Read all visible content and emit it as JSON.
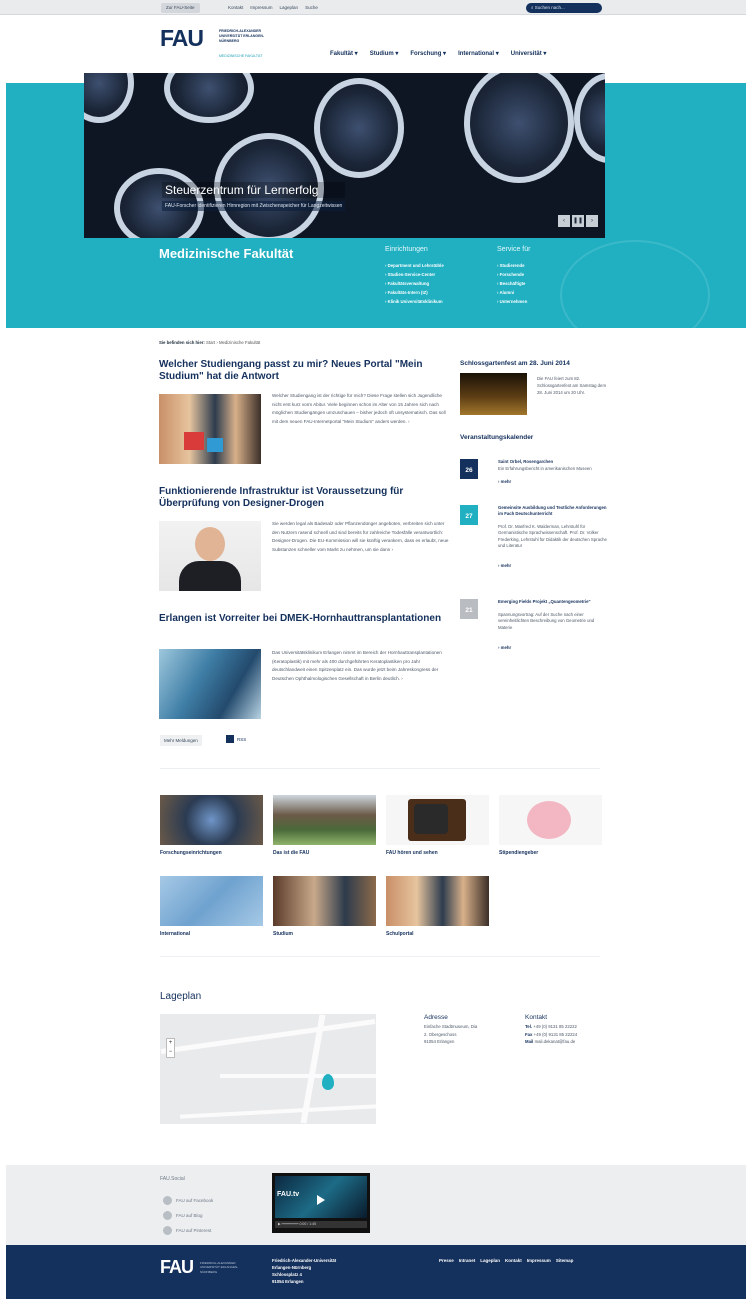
{
  "topbar": {
    "home": "Zur FAU-Seite",
    "links": [
      "Kontakt",
      "Impressum",
      "Lageplan",
      "Suche"
    ],
    "search_placeholder": "Suchen nach..."
  },
  "header": {
    "logo": "FAU",
    "logo_sub": "FRIEDRICH-ALEXANDER UNIVERSITÄT ERLANGEN-NÜRNBERG",
    "faculty_sub": "MEDIZINISCHE FAKULTÄT",
    "nav": [
      "Fakultät ▾",
      "Studium ▾",
      "Forschung ▾",
      "International ▾",
      "Universität ▾"
    ]
  },
  "hero": {
    "title": "Steuerzentrum für Lernerfolg",
    "subtitle": "FAU-Forscher identifizieren Hirnregion mit Zwischenspeicher für Langzeitwissen",
    "controls": [
      "‹",
      "❚❚",
      "›"
    ]
  },
  "faculty": {
    "name": "Medizinische Fakultät",
    "einrichtungen_h": "Einrichtungen",
    "einrichtungen": [
      "Department und Lehrstühle",
      "Studien-Service-Center",
      "Fakultätsverwaltung",
      "Fakultäts-Intern (IZ)",
      "Klinik Universitätsklinikum"
    ],
    "service_h": "Service für",
    "service": [
      "Studierende",
      "Forschende",
      "Beschäftigte",
      "Alumni",
      "Unternehmen"
    ]
  },
  "breadcrumb": {
    "label": "Sie befinden sich hier:",
    "path": "Start › Medizinische Fakultät"
  },
  "articles": [
    {
      "title": "Welcher Studiengang passt zu mir? Neues Portal \"Mein Studium\" hat die Antwort",
      "text": "Welcher Studiengang ist der richtige für mich? Diese Frage stellen sich Jugendliche nicht erst kurz vorm Abitur. Viele beginnen schon im Alter von 15 Jahren sich nach möglichen Studiengängen umzuschauen – bisher jedoch oft unsystematisch. Das soll mit dem neuen FAU-Internetportal \"Mein Studium\" anders werden. ›"
    },
    {
      "title": "Funktionierende Infrastruktur ist Voraussetzung für Überprüfung von Designer-Drogen",
      "text": "Sie werden legal als Badesalz oder Pflanzendünger angeboten, verbreiten sich unter den Nutzern rasend schnell und sind bereits für zahlreiche Todesfälle verantwortlich: Designer-Drogen. Die EU-Kommission will sie künftig verankern, dass es erlaubt, neue Substanzen schneller vom Markt zu nehmen, um sie dann ›"
    },
    {
      "title": "Erlangen ist Vorreiter bei DMEK-Hornhauttransplantationen",
      "text": "Das Universitätsklinikum Erlangen nimmt im Bereich der Hornhauttransplantationen (Keratoplastik) mit mehr als 400 durchgeführten Keratoplastiken pro Jahr deutschlandweit einen Spitzenplatz ein. Das wurde jetzt beim Jahreskongress der Deutschen Ophthalmologischen Gesellschaft in Berlin deutlich. ›"
    }
  ],
  "more": {
    "button": "Mehr Meldungen",
    "rss": "RSS"
  },
  "sidebar": {
    "feature_title": "Schlossgartenfest am 28. Juni 2014",
    "feature_text": "Die FAU feiert zum 82. Schlossgartenfest am Samstag dem 28. Juni 2014 um 20 Uhr.",
    "cal_title": "Veranstaltungskalender",
    "events": [
      {
        "day": "26",
        "title": "Saint Orbel, Rosengarchen",
        "text": "Ein Erfahrungsbericht in amerikanischen Museen",
        "more": "› mehr"
      },
      {
        "day": "27",
        "title": "Gemeinsite Ausbildung und Textliche Anforderungen im Fach Deutschunterricht",
        "text": "Prof. Dr. Manfred K. Walderman, Lehrstuhl für Germanistische Sprachwissenschaft. Prof. Dr. Volker Frederking, Lehrstuhl für Didaktik der deutschen Sprache und Literatur",
        "more": "› mehr"
      },
      {
        "day": "21",
        "title": "Emerging Fields Projekt „Quantengeometrie\"",
        "text": "Spannungsvortrag: Auf der Suche nach einer vereinheitlichten Beschreibung von Geometrie und Materie",
        "more": "› mehr"
      }
    ]
  },
  "tiles": [
    {
      "label": "Forschungseinrichtungen"
    },
    {
      "label": "Das ist die FAU"
    },
    {
      "label": "FAU hören und sehen"
    },
    {
      "label": "Stipendiengeber"
    },
    {
      "label": "International"
    },
    {
      "label": "Studium"
    },
    {
      "label": "Schulportal"
    }
  ],
  "location": {
    "title": "Lageplan",
    "addr_h": "Adresse",
    "addr": [
      "Einfache Stadtmuseum, Dia",
      "2. Obergeschoss",
      "91054 Erlangen"
    ],
    "contact_h": "Kontakt",
    "tel_l": "Tel.",
    "tel": "+49 (0) 9131 85 22222",
    "fax_l": "Fax",
    "fax": "+49 (0) 9131 85 22224",
    "mail_l": "Mail",
    "mail": "mail.dekanat@fau.de"
  },
  "footer": {
    "social_title": "FAU.Social",
    "social": [
      "FAU auf Facebook",
      "FAU auf Blog",
      "FAU auf Pinterest"
    ],
    "video_title": "FAU.tv",
    "video_bar": "▶ ━━━━━━━━ 0:00 / 1:45",
    "logo": "FAU",
    "logo_sub": "FRIEDRICH-ALEXANDER UNIVERSITÄT ERLANGEN-NÜRNBERG",
    "address": [
      "Friedrich-Alexander-Universität",
      "Erlangen-Nürnberg",
      "Schlossplatz 4",
      "91054 Erlangen"
    ],
    "links": [
      "Presse",
      "Intranet",
      "Lageplan",
      "Kontakt",
      "Impressum",
      "Sitemap"
    ]
  },
  "colors": {
    "navy": "#14305c",
    "teal": "#20b0c2"
  }
}
